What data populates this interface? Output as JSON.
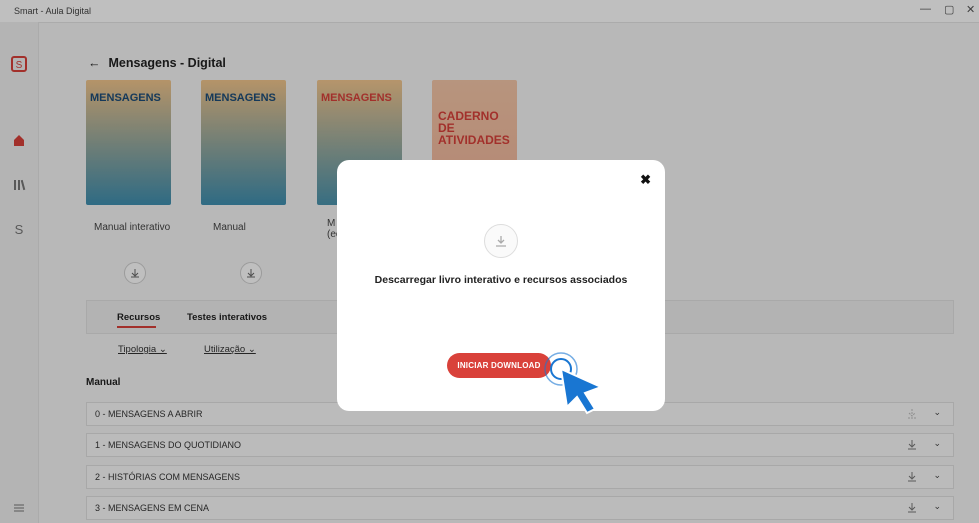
{
  "window": {
    "title": "Smart - Aula Digital",
    "minimize": "—",
    "restore": "▢",
    "close": "✕"
  },
  "sidebar": {
    "icons": [
      "logo-icon",
      "home-icon",
      "library-icon",
      "smart-icon",
      "settings-icon"
    ]
  },
  "header": {
    "back": "←",
    "title": "Mensagens - Digital"
  },
  "books": [
    {
      "label": "Manual interativo",
      "cover_title": "MENSAGENS"
    },
    {
      "label": "Manual",
      "cover_title": "MENSAGENS"
    },
    {
      "label": "M\n(ec",
      "cover_title": "MENSAGENS"
    },
    {
      "label": "",
      "cover_title": "CADERNO DE ATIVIDADES"
    }
  ],
  "tabs": {
    "active": "Recursos",
    "other": "Testes interativos"
  },
  "filters": {
    "tipologia": "Tipologia ⌄",
    "utilizacao": "Utilização ⌄"
  },
  "section": {
    "title": "Manual"
  },
  "rows": [
    {
      "label": "0 - MENSAGENS A ABRIR"
    },
    {
      "label": "1 - MENSAGENS DO QUOTIDIANO"
    },
    {
      "label": "2 - HISTÓRIAS COM MENSAGENS"
    },
    {
      "label": "3 - MENSAGENS EM CENA"
    }
  ],
  "modal": {
    "message": "Descarregar livro interativo e recursos associados",
    "button": "INICIAR DOWNLOAD"
  },
  "colors": {
    "accent": "#d9413a",
    "cursor": "#1976d2"
  }
}
